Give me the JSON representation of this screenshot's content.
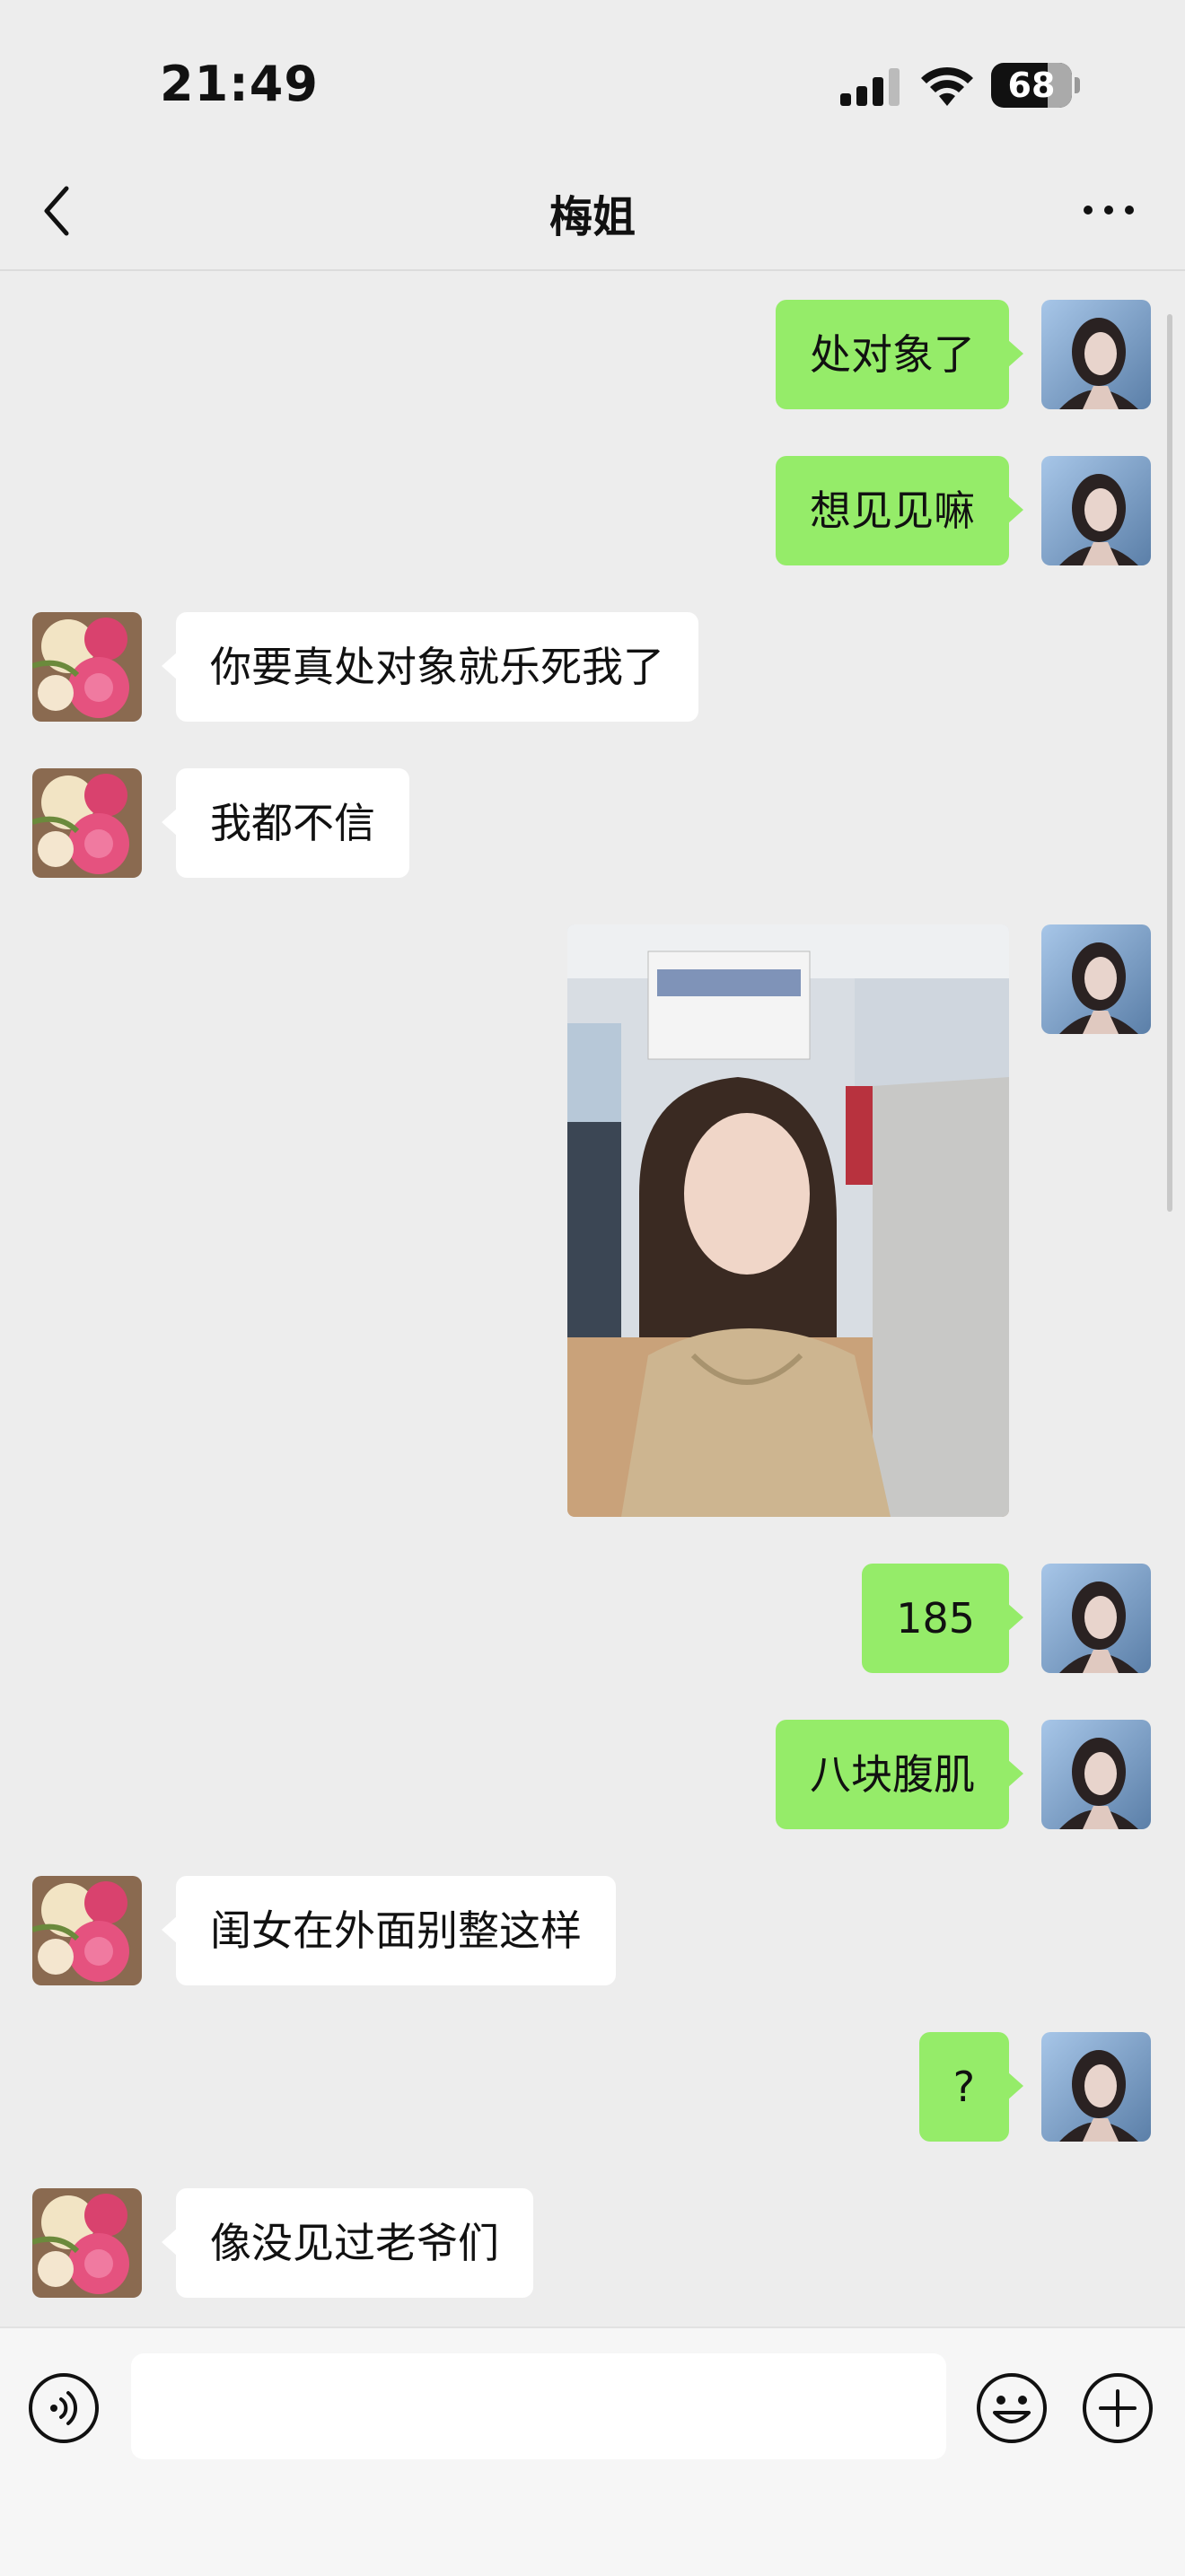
{
  "status_bar": {
    "time": "21:49",
    "battery": "68",
    "battery_level": 0.68
  },
  "nav": {
    "title": "梅姐",
    "back_icon": "chevron-left-icon",
    "more_icon": "ellipsis-icon"
  },
  "messages": [
    {
      "side": "right",
      "type": "text",
      "text": "处对象了"
    },
    {
      "side": "right",
      "type": "text",
      "text": "想见见嘛"
    },
    {
      "side": "left",
      "type": "text",
      "text": "你要真处对象就乐死我了"
    },
    {
      "side": "left",
      "type": "text",
      "text": "我都不信"
    },
    {
      "side": "right",
      "type": "image"
    },
    {
      "side": "right",
      "type": "text",
      "text": "185"
    },
    {
      "side": "right",
      "type": "text",
      "text": "八块腹肌"
    },
    {
      "side": "left",
      "type": "text",
      "text": "闺女在外面别整这样"
    },
    {
      "side": "right",
      "type": "text",
      "text": "?"
    },
    {
      "side": "left",
      "type": "text",
      "text": "像没见过老爷们"
    }
  ],
  "input_bar": {
    "voice_icon": "voice-icon",
    "input_value": "",
    "emoji_icon": "emoji-icon",
    "plus_icon": "plus-icon"
  },
  "colors": {
    "sent_bubble": "#95ec69",
    "received_bubble": "#ffffff",
    "background": "#ededed"
  }
}
